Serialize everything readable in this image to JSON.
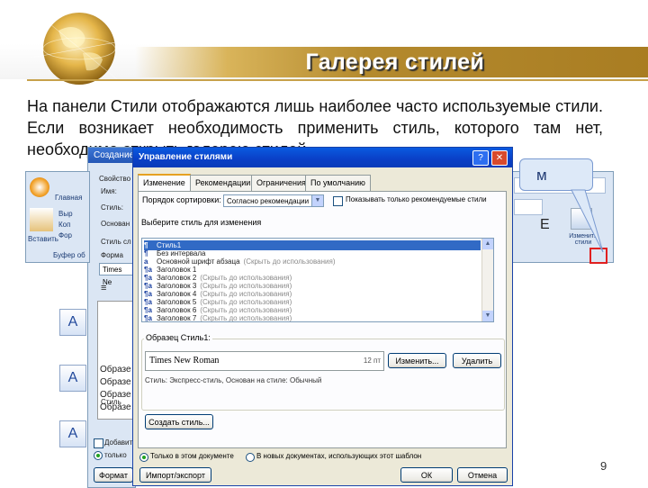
{
  "slide": {
    "title": "Галерея стилей",
    "body_text": "На панели Стили отображаются лишь наиболее часто используемые стили. Если возникает необходимость применить стиль, которого там нет, необходимо открыть галерею стилей",
    "page_number": "9",
    "callout_text": "м"
  },
  "background_windows": {
    "left_panel": {
      "title": "Создание",
      "items": [
        "Свойство",
        "Имя:",
        "Стиль:",
        "Основан",
        "Стиль сл",
        "Форма",
        "Times Ne"
      ],
      "samples": [
        "Образе",
        "Образе",
        "Образе",
        "Образе",
        "Образе",
        "Стиль"
      ],
      "checkbox_label": "Добавит",
      "radio_label": "только",
      "bottom_button": "Формат"
    },
    "ribbon": {
      "tab": "Главная",
      "paste_label": "Вставить",
      "clipboard_label": "Буфер об",
      "items": [
        "Выр",
        "Коп",
        "Фор"
      ],
      "right_label": "Изменить стили",
      "right_letter": "Е"
    }
  },
  "dialog": {
    "title": "Управление стилями",
    "controls": [
      "?",
      "✕"
    ],
    "tabs": [
      "Изменение",
      "Рекомендации",
      "Ограничения",
      "По умолчанию"
    ],
    "sort_label": "Порядок сортировки:",
    "sort_value": "Согласно рекомендации",
    "recommended_checkbox": "Показывать только рекомендуемые стили",
    "select_label": "Выберите стиль для изменения",
    "styles": [
      {
        "icon": "¶",
        "name": "Стиль1",
        "note": "",
        "selected": true
      },
      {
        "icon": "¶",
        "name": "Без интервала",
        "note": "",
        "selected": false
      },
      {
        "icon": "a",
        "name": "Основной шрифт абзаца",
        "note": "(Скрыть до использования)",
        "selected": false
      },
      {
        "icon": "¶a",
        "name": "Заголовок 1",
        "note": "",
        "selected": false
      },
      {
        "icon": "¶a",
        "name": "Заголовок 2",
        "note": "(Скрыть до использования)",
        "selected": false
      },
      {
        "icon": "¶a",
        "name": "Заголовок 3",
        "note": "(Скрыть до использования)",
        "selected": false
      },
      {
        "icon": "¶a",
        "name": "Заголовок 4",
        "note": "(Скрыть до использования)",
        "selected": false
      },
      {
        "icon": "¶a",
        "name": "Заголовок 5",
        "note": "(Скрыть до использования)",
        "selected": false
      },
      {
        "icon": "¶a",
        "name": "Заголовок 6",
        "note": "(Скрыть до использования)",
        "selected": false
      },
      {
        "icon": "¶a",
        "name": "Заголовок 7",
        "note": "(Скрыть до использования)",
        "selected": false
      }
    ],
    "preview_label": "Образец Стиль1:",
    "preview_font": "Times New Roman",
    "preview_size": "12 пт",
    "modify_button": "Изменить...",
    "delete_button": "Удалить",
    "description": "Стиль: Экспресс-стиль, Основан на стиле: Обычный",
    "new_style_button": "Создать стиль...",
    "radio_this_doc": "Только в этом документе",
    "radio_new_docs": "В новых документах, использующих этот шаблон",
    "import_button": "Импорт/экспорт",
    "ok_button": "ОК",
    "cancel_button": "Отмена"
  },
  "colors": {
    "title_gold": "#b48a2e",
    "dialog_title_blue": "#0a47d0",
    "selection_blue": "#316ac5",
    "highlight_red": "#e02020"
  }
}
